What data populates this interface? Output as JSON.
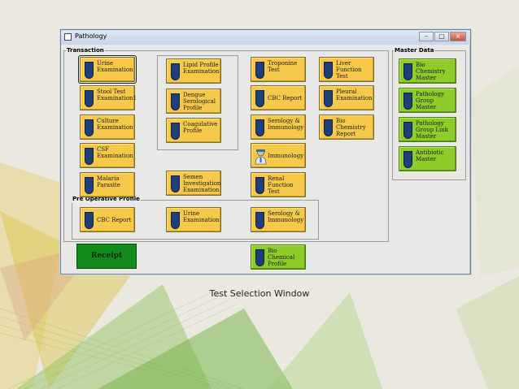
{
  "window": {
    "title": "Pathology",
    "controls": {
      "minimize": "–",
      "maximize": "□",
      "close": "×"
    }
  },
  "groups": {
    "transaction": "Transaction",
    "pre_operative": "Pre Operative Profile",
    "master_data": "Master Data"
  },
  "transaction": {
    "col1": [
      "Urine Examination",
      "Stool Test Examination1",
      "Culture Examination",
      "CSF Examination",
      "Malaria Parasite"
    ],
    "col2": [
      "Lipid Profile Examination",
      "Dengue Serological Profile",
      "Coagulative Profile",
      "Semen Investigation Examination"
    ],
    "col3": [
      "Troponine Test",
      "CBC Report",
      "Serology & Immunology",
      "Immunology",
      "Renal Function Test"
    ],
    "col4": [
      "Liver Function Test",
      "Pleural Examination",
      "Bio Chemistry Report"
    ]
  },
  "pre_operative": [
    "CBC Report",
    "Urine Examination",
    "Serology & Immunology"
  ],
  "master": [
    "Bio Chemistry Master",
    "Pathology Group Master",
    "Pathology Group Link Master",
    "Antibiotic Master"
  ],
  "bio_chemical": "Bio Chemical Profile",
  "receipt": "Receipt",
  "caption": "Test Selection Window",
  "colors": {
    "yellow_button": "#f6c94b",
    "green_button": "#8fcc2a",
    "receipt": "#138a1c",
    "shield": "#1f3f78"
  }
}
